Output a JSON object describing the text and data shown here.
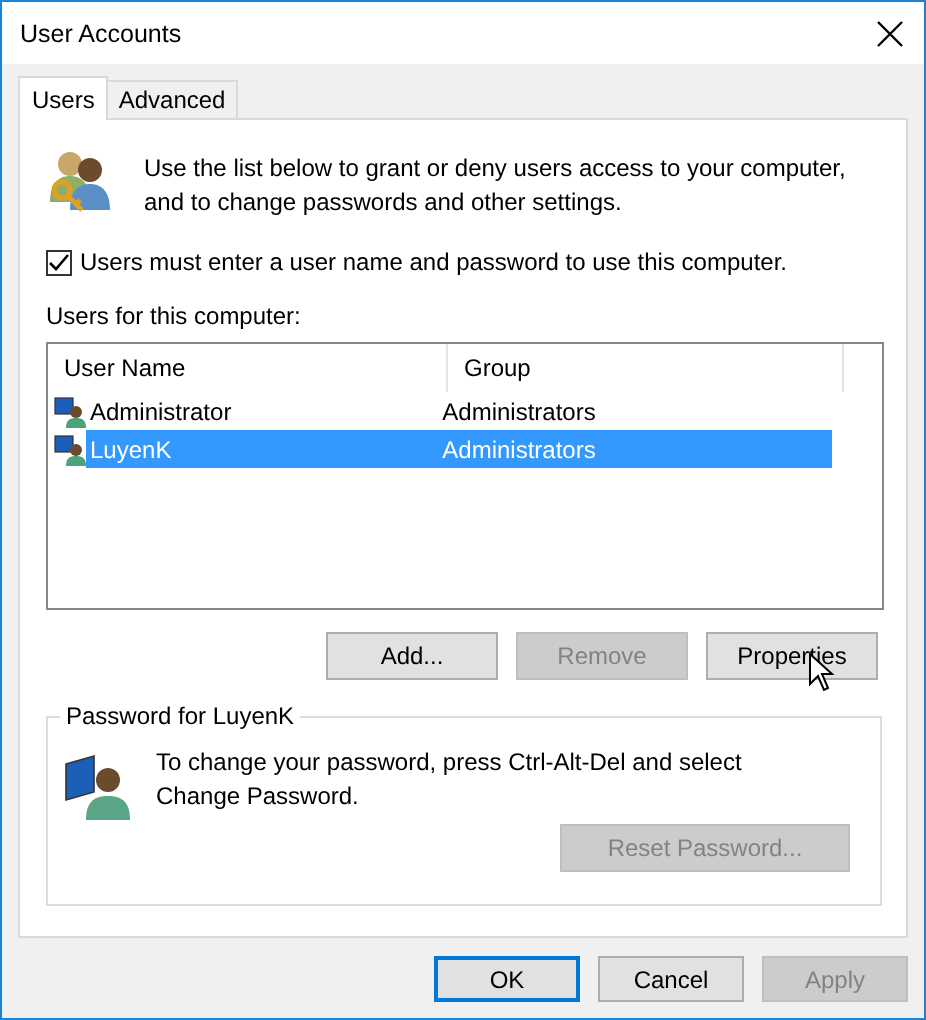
{
  "window": {
    "title": "User Accounts"
  },
  "tabs": [
    {
      "label": "Users",
      "selected": true
    },
    {
      "label": "Advanced",
      "selected": false
    }
  ],
  "intro": "Use the list below to grant or deny users access to your computer, and to change passwords and other settings.",
  "require_login": {
    "label": "Users must enter a user name and password to use this computer.",
    "checked": true
  },
  "users_label": "Users for this computer:",
  "table": {
    "columns": [
      "User Name",
      "Group"
    ],
    "rows": [
      {
        "name": "Administrator",
        "group": "Administrators",
        "selected": false
      },
      {
        "name": "LuyenK",
        "group": "Administrators",
        "selected": true
      }
    ]
  },
  "list_buttons": [
    {
      "label": "Add...",
      "disabled": false
    },
    {
      "label": "Remove",
      "disabled": true
    },
    {
      "label": "Properties",
      "disabled": false
    }
  ],
  "password_group": {
    "title": "Password for LuyenK",
    "text": "To change your password, press Ctrl-Alt-Del and select Change Password.",
    "button": {
      "label": "Reset Password...",
      "disabled": true
    }
  },
  "dialog_buttons": [
    {
      "label": "OK",
      "disabled": false,
      "default": true
    },
    {
      "label": "Cancel",
      "disabled": false,
      "default": false
    },
    {
      "label": "Apply",
      "disabled": true,
      "default": false
    }
  ]
}
